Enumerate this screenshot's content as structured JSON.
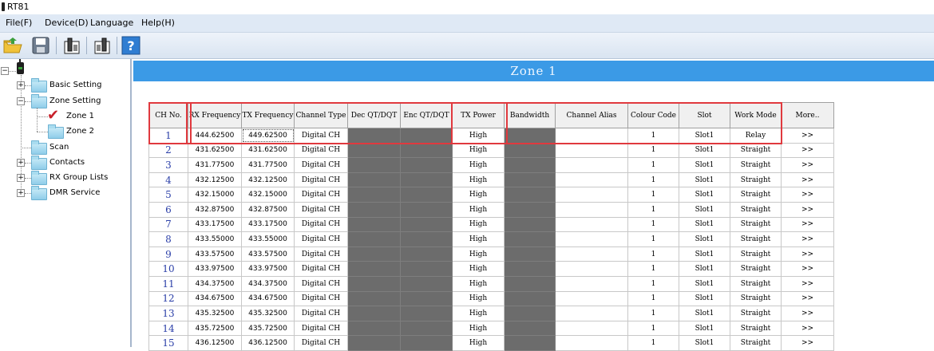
{
  "window": {
    "title": "RT81"
  },
  "menu": [
    {
      "label": "File(F)"
    },
    {
      "label": "Device(D)"
    },
    {
      "label": "Language"
    },
    {
      "label": "Help(H)"
    }
  ],
  "toolbar": [
    "open-icon",
    "save-icon",
    "read-radio-icon",
    "write-radio-icon",
    "help-icon"
  ],
  "tree": {
    "items": [
      {
        "label": "Basic Setting"
      },
      {
        "label": "Zone Setting"
      },
      {
        "label": "Zone 1"
      },
      {
        "label": "Zone 2"
      },
      {
        "label": "Scan"
      },
      {
        "label": "Contacts"
      },
      {
        "label": "RX Group Lists"
      },
      {
        "label": "DMR Service"
      }
    ]
  },
  "zone": {
    "title": "Zone 1"
  },
  "table": {
    "columns": [
      "CH No.",
      "RX Frequency",
      "TX Frequency",
      "Channel Type",
      "Dec QT/DQT",
      "Enc QT/DQT",
      "TX Power",
      "Bandwidth",
      "Channel Alias",
      "Colour Code",
      "Slot",
      "Work Mode",
      "More.."
    ],
    "rows": [
      {
        "ch": "1",
        "rx": "444.62500",
        "tx": "449.62500",
        "type": "Digital CH",
        "power": "High",
        "alias": "",
        "cc": "1",
        "slot": "Slot1",
        "mode": "Relay",
        "more": ">>"
      },
      {
        "ch": "2",
        "rx": "431.62500",
        "tx": "431.62500",
        "type": "Digital CH",
        "power": "High",
        "alias": "",
        "cc": "1",
        "slot": "Slot1",
        "mode": "Straight",
        "more": ">>"
      },
      {
        "ch": "3",
        "rx": "431.77500",
        "tx": "431.77500",
        "type": "Digital CH",
        "power": "High",
        "alias": "",
        "cc": "1",
        "slot": "Slot1",
        "mode": "Straight",
        "more": ">>"
      },
      {
        "ch": "4",
        "rx": "432.12500",
        "tx": "432.12500",
        "type": "Digital CH",
        "power": "High",
        "alias": "",
        "cc": "1",
        "slot": "Slot1",
        "mode": "Straight",
        "more": ">>"
      },
      {
        "ch": "5",
        "rx": "432.15000",
        "tx": "432.15000",
        "type": "Digital CH",
        "power": "High",
        "alias": "",
        "cc": "1",
        "slot": "Slot1",
        "mode": "Straight",
        "more": ">>"
      },
      {
        "ch": "6",
        "rx": "432.87500",
        "tx": "432.87500",
        "type": "Digital CH",
        "power": "High",
        "alias": "",
        "cc": "1",
        "slot": "Slot1",
        "mode": "Straight",
        "more": ">>"
      },
      {
        "ch": "7",
        "rx": "433.17500",
        "tx": "433.17500",
        "type": "Digital CH",
        "power": "High",
        "alias": "",
        "cc": "1",
        "slot": "Slot1",
        "mode": "Straight",
        "more": ">>"
      },
      {
        "ch": "8",
        "rx": "433.55000",
        "tx": "433.55000",
        "type": "Digital CH",
        "power": "High",
        "alias": "",
        "cc": "1",
        "slot": "Slot1",
        "mode": "Straight",
        "more": ">>"
      },
      {
        "ch": "9",
        "rx": "433.57500",
        "tx": "433.57500",
        "type": "Digital CH",
        "power": "High",
        "alias": "",
        "cc": "1",
        "slot": "Slot1",
        "mode": "Straight",
        "more": ">>"
      },
      {
        "ch": "10",
        "rx": "433.97500",
        "tx": "433.97500",
        "type": "Digital CH",
        "power": "High",
        "alias": "",
        "cc": "1",
        "slot": "Slot1",
        "mode": "Straight",
        "more": ">>"
      },
      {
        "ch": "11",
        "rx": "434.37500",
        "tx": "434.37500",
        "type": "Digital CH",
        "power": "High",
        "alias": "",
        "cc": "1",
        "slot": "Slot1",
        "mode": "Straight",
        "more": ">>"
      },
      {
        "ch": "12",
        "rx": "434.67500",
        "tx": "434.67500",
        "type": "Digital CH",
        "power": "High",
        "alias": "",
        "cc": "1",
        "slot": "Slot1",
        "mode": "Straight",
        "more": ">>"
      },
      {
        "ch": "13",
        "rx": "435.32500",
        "tx": "435.32500",
        "type": "Digital CH",
        "power": "High",
        "alias": "",
        "cc": "1",
        "slot": "Slot1",
        "mode": "Straight",
        "more": ">>"
      },
      {
        "ch": "14",
        "rx": "435.72500",
        "tx": "435.72500",
        "type": "Digital CH",
        "power": "High",
        "alias": "",
        "cc": "1",
        "slot": "Slot1",
        "mode": "Straight",
        "more": ">>"
      },
      {
        "ch": "15",
        "rx": "436.12500",
        "tx": "436.12500",
        "type": "Digital CH",
        "power": "High",
        "alias": "",
        "cc": "1",
        "slot": "Slot1",
        "mode": "Straight",
        "more": ">>"
      }
    ]
  },
  "colors": {
    "header_blue": "#3b9ae6",
    "disabled_cell": "#6c6c6c",
    "highlight_red": "#e0393e",
    "channel_number": "#2b3fa8"
  }
}
